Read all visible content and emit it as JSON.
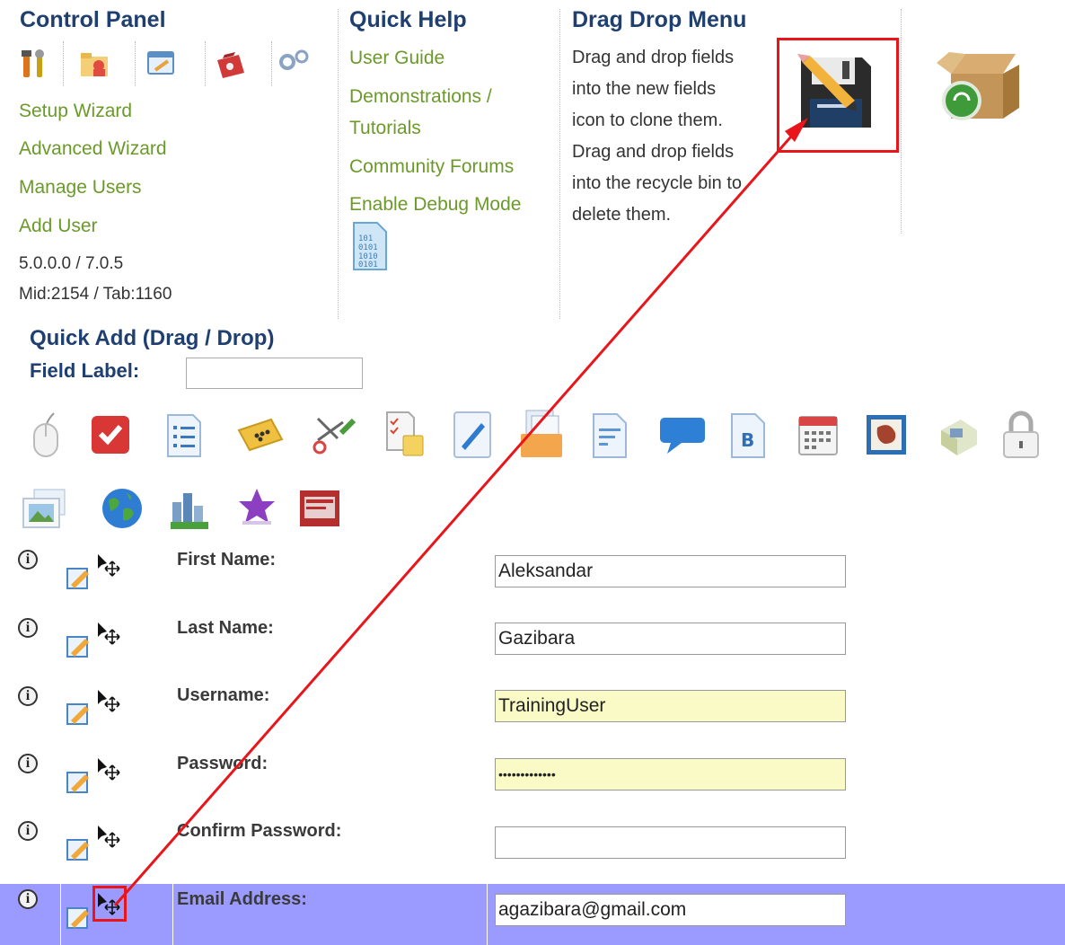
{
  "control_panel": {
    "title": "Control Panel",
    "icons": [
      "tools-icon",
      "users-folder-icon",
      "window-wizard-icon",
      "toolbox-icon",
      "gears-icon"
    ],
    "links": [
      "Setup Wizard",
      "Advanced Wizard",
      "Manage Users",
      "Add User"
    ],
    "version": "5.0.0.0 / 7.0.5",
    "ids": "Mid:2154 / Tab:1160"
  },
  "quick_help": {
    "title": "Quick Help",
    "links": [
      "User Guide",
      "Demonstrations /",
      "Tutorials",
      "Community Forums",
      "Enable Debug Mode"
    ]
  },
  "drag_drop": {
    "title": "Drag Drop Menu",
    "lines": [
      "Drag and drop fields",
      "into the new fields",
      "icon to clone them.",
      "Drag and drop fields",
      "into the recycle bin to",
      "delete them."
    ]
  },
  "quick_add": {
    "title": "Quick Add (Drag / Drop)",
    "field_label": "Field Label:",
    "field_label_value": ""
  },
  "fields": [
    {
      "label": "First Name:",
      "value": "Aleksandar",
      "highlight": false
    },
    {
      "label": "Last Name:",
      "value": "Gazibara",
      "highlight": false
    },
    {
      "label": "Username:",
      "value": "TrainingUser",
      "highlight": true
    },
    {
      "label": "Password:",
      "value": "•••••••••••••",
      "highlight": true
    },
    {
      "label": "Confirm Password:",
      "value": "",
      "highlight": false
    },
    {
      "label": "Email Address:",
      "value": "agazibara@gmail.com",
      "highlight": false
    }
  ],
  "colors": {
    "heading": "#1e3f70",
    "link": "#6b9a2a",
    "highlight_row": "#9b9bff",
    "annotation_red": "#e8151b",
    "yellow_input": "#fafac6"
  }
}
